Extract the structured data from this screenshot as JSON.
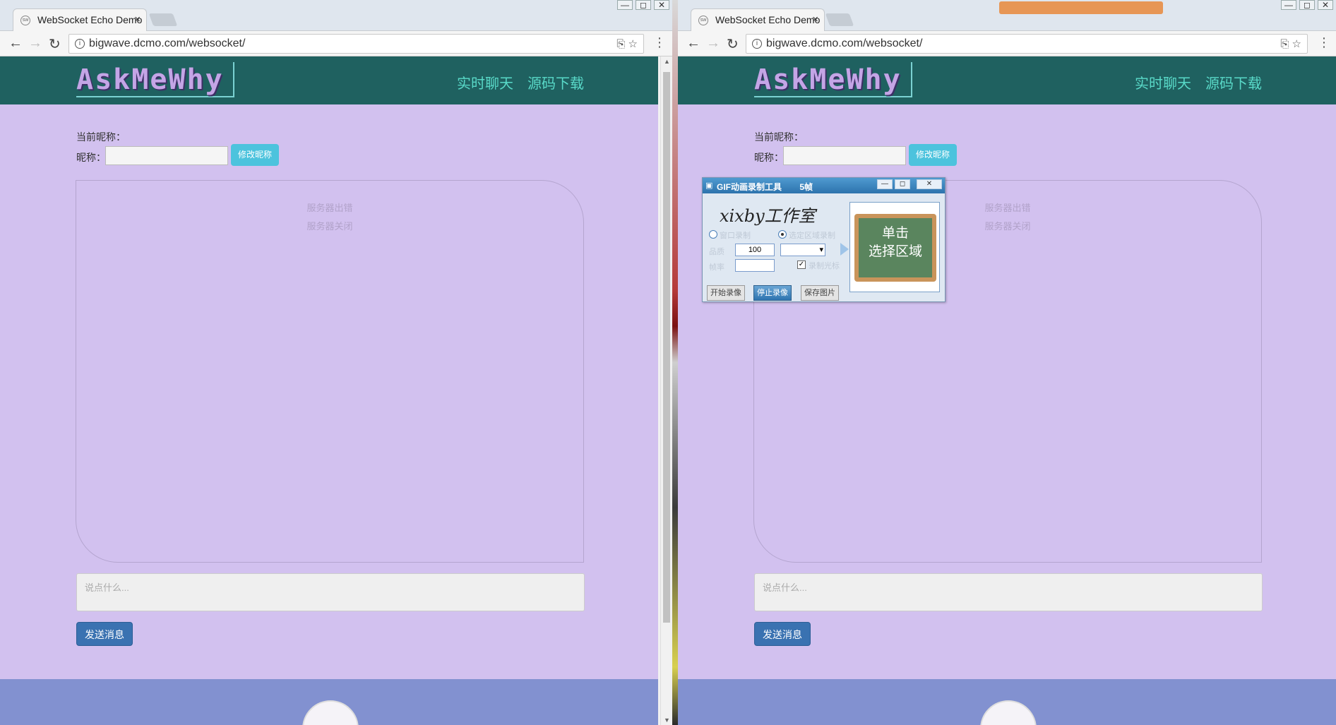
{
  "browser": {
    "tab_title": "WebSocket Echo Demo",
    "tab_close": "×",
    "url": "bigwave.dcmo.com/websocket/",
    "favicon_text": "sw",
    "menu": "⋮",
    "back": "←",
    "forward": "→",
    "reload": "↻",
    "info": "i",
    "translate": "⎘",
    "star": "☆",
    "win_min": "—",
    "win_max": "◻",
    "win_close": "✕"
  },
  "site": {
    "logo": "AskMeWhy",
    "nav_chat": "实时聊天",
    "nav_source": "源码下载",
    "current_nick_label": "当前昵称：",
    "nick_label": "昵称：",
    "nick_value": "",
    "change_nick_button": "修改昵称",
    "server_error": "服务器出错",
    "server_closed": "服务器关闭",
    "message_placeholder": "说点什么...",
    "send_button": "发送消息"
  },
  "gif_tool": {
    "title": "GIF动画录制工具",
    "frames": "5帧",
    "signature": "xixby工作室",
    "mode_window": "窗口录制",
    "mode_area": "选定区域录制",
    "quality_label": "品质",
    "quality_value": "100",
    "fps_label": "帧率",
    "fps_value": "",
    "show_cursor": "录制光标",
    "check_mark": "✓",
    "dropdown_arrow": "▾",
    "start_button": "开始录像",
    "stop_button": "停止录像",
    "save_button": "保存图片",
    "board_line1": "单击",
    "board_line2": "选择区域"
  },
  "colors": {
    "page_bg": "#d2c1ef",
    "header_bg": "#1f6160",
    "nav_link": "#59d9c8",
    "button_teal": "#4cc3dd",
    "button_blue": "#3a72b1",
    "footer_bg": "#8291d0"
  }
}
